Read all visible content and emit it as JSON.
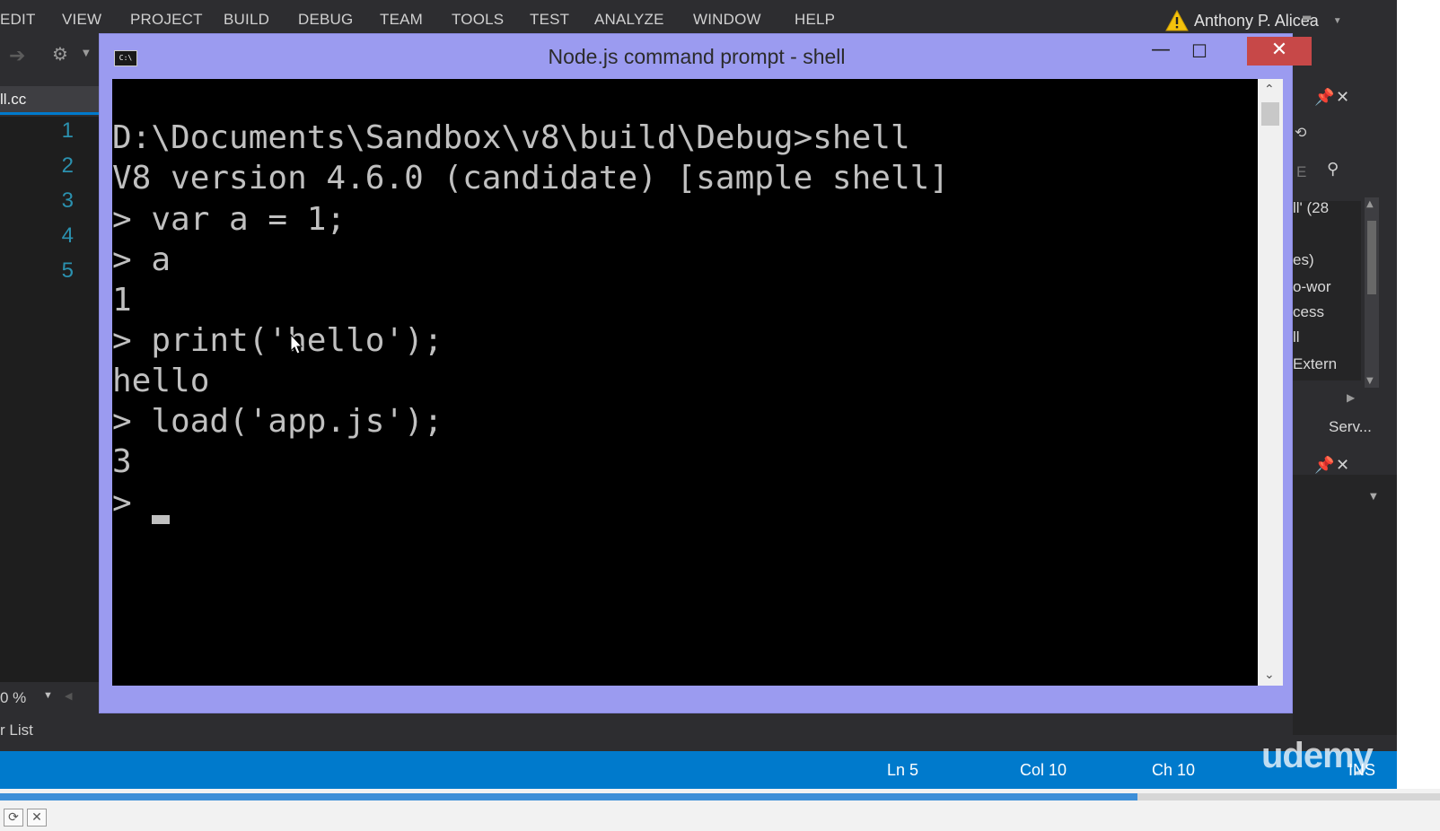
{
  "menu": {
    "items": [
      "EDIT",
      "VIEW",
      "PROJECT",
      "BUILD",
      "DEBUG",
      "TEAM",
      "TOOLS",
      "TEST",
      "ANALYZE",
      "WINDOW",
      "HELP"
    ],
    "user_name": "Anthony P. Alicea"
  },
  "editor": {
    "tab_label": "ll.cc",
    "line_numbers": [
      "1",
      "2",
      "3",
      "4",
      "5"
    ],
    "zoom_label": "0 %",
    "bottom_tab_label": "r List"
  },
  "console": {
    "title": "Node.js command prompt - shell",
    "icon_text": "C:\\",
    "lines": [
      "D:\\Documents\\Sandbox\\v8\\build\\Debug>shell",
      "V8 version 4.6.0 (candidate) [sample shell]",
      "> var a = 1;",
      "> a",
      "1",
      "> print('hello');",
      "hello",
      "> load('app.js');",
      "3",
      ">"
    ]
  },
  "right_panel": {
    "items": [
      "ll' (28",
      "es)",
      "o-wor",
      "cess",
      "ll",
      "Extern"
    ],
    "search_placeholder": "E",
    "servers_label": "Serv..."
  },
  "status_bar": {
    "line": "Ln 5",
    "column": "Col 10",
    "char": "Ch 10",
    "mode": "INS"
  },
  "watermark": "udemy",
  "video": {
    "progress": 0.79
  }
}
